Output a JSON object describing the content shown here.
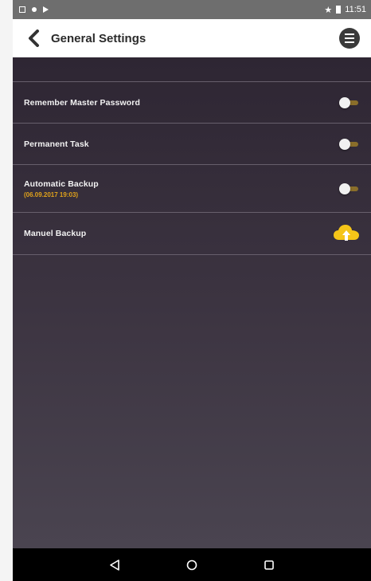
{
  "status_bar": {
    "left_icons": [
      "notification-icon",
      "dot-icon",
      "media-icon"
    ],
    "right_icons": [
      "star-icon",
      "battery-icon"
    ],
    "time": "11:51"
  },
  "header": {
    "back_icon": "chevron-left-icon",
    "title": "General Settings",
    "menu_icon": "menu-icon"
  },
  "settings": {
    "remember_master_password": {
      "label": "Remember Master Password",
      "enabled": false
    },
    "permanent_task": {
      "label": "Permanent Task",
      "enabled": false
    },
    "automatic_backup": {
      "label": "Automatic Backup",
      "sub": "(06.09.2017 19:03)",
      "enabled": false
    },
    "manual_backup": {
      "label": "Manuel Backup",
      "icon": "cloud-upload-icon"
    }
  },
  "nav_bar": {
    "icons": [
      "back-icon",
      "home-icon",
      "recents-icon"
    ]
  },
  "colors": {
    "accent": "#f5c518",
    "date": "#e0a21b",
    "background": "#39323f",
    "header": "#ffffff",
    "toggle_track": "#8a6e2a"
  }
}
